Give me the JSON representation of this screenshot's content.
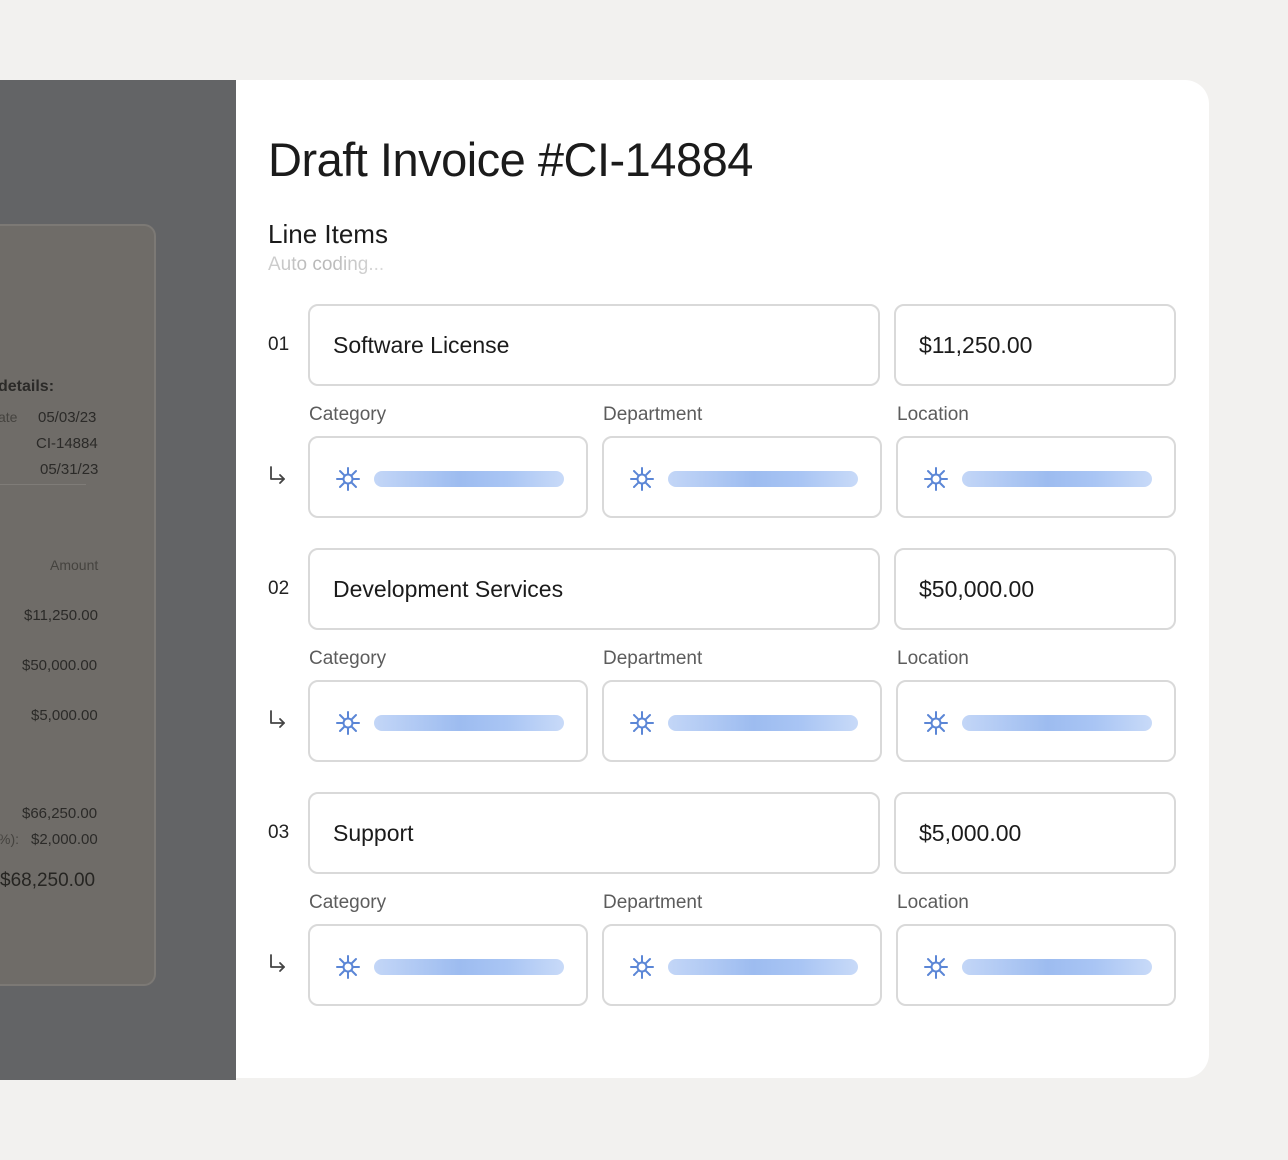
{
  "document": {
    "section_label": "details:",
    "detail_rows": [
      {
        "label": "ate",
        "value": "05/03/23"
      },
      {
        "label": "",
        "value": "CI-14884"
      },
      {
        "label": "",
        "value": "05/31/23"
      }
    ],
    "amount_header": "Amount",
    "amounts": [
      "$11,250.00",
      "$50,000.00",
      "$5,000.00"
    ],
    "subtotal": "$66,250.00",
    "tax_label": "%):",
    "tax": "$2,000.00",
    "total": "$68,250.00"
  },
  "invoice": {
    "title": "Draft Invoice #CI-14884",
    "section_title": "Line Items",
    "status": "Auto coding..."
  },
  "field_labels": {
    "category": "Category",
    "department": "Department",
    "location": "Location"
  },
  "line_items": [
    {
      "number": "01",
      "description": "Software License",
      "amount": "$11,250.00"
    },
    {
      "number": "02",
      "description": "Development Services",
      "amount": "$50,000.00"
    },
    {
      "number": "03",
      "description": "Support",
      "amount": "$5,000.00"
    }
  ],
  "colors": {
    "accent": "#5b86d6",
    "loading": "#a9c5f4",
    "overlay": "#636466"
  },
  "icons": {
    "sub_row": "return-arrow-icon",
    "coding": "sparkle-icon"
  }
}
